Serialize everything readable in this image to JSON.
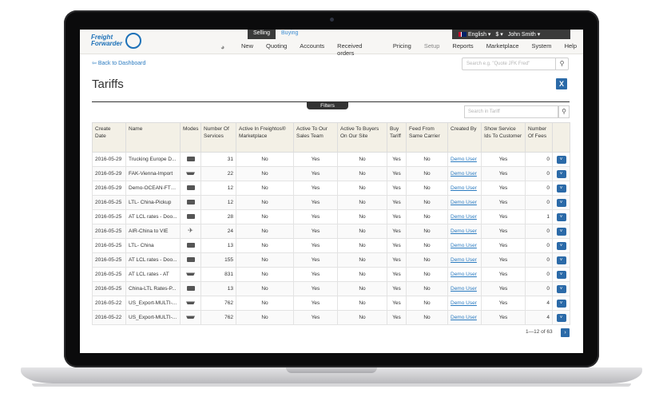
{
  "brand": {
    "logo_line1": "Freight",
    "logo_line2": "Forwarder"
  },
  "mode": {
    "selling": "Selling",
    "buying": "Buying"
  },
  "account": {
    "language": "English",
    "currency": "$",
    "user": "John Smith"
  },
  "nav": [
    "New",
    "Quoting",
    "Accounts",
    "Received orders",
    "Pricing",
    "Setup",
    "Reports",
    "Marketplace",
    "System",
    "Help"
  ],
  "back_link": "Back to Dashboard",
  "search_top_placeholder": "Search e.g. \"Quote JFK Fred\"",
  "page_title": "Tariffs",
  "filters_label": "Filters",
  "search_tariff_placeholder": "Search in Tariff",
  "table": {
    "headers": [
      "Create Date",
      "Name",
      "Modes",
      "Number Of Services",
      "Active In Freightos® Marketplace",
      "Active To Our Sales Team",
      "Active To Buyers On Our Site",
      "Buy Tariff",
      "Feed From Same Carrier",
      "Created By",
      "Show Service Ids To Customer",
      "Number Of Fees",
      ""
    ],
    "rows": [
      {
        "date": "2016-05-29",
        "name": "Trucking Europe D...",
        "mode": "truck",
        "services": "31",
        "marketplace": "No",
        "sales": "Yes",
        "buyers": "No",
        "buy": "Yes",
        "feed": "No",
        "created_by": "Demo User",
        "show_ids": "Yes",
        "fees": "0"
      },
      {
        "date": "2016-05-29",
        "name": "FAK-Vienna-Import",
        "mode": "ship",
        "services": "22",
        "marketplace": "No",
        "sales": "Yes",
        "buyers": "No",
        "buy": "Yes",
        "feed": "No",
        "created_by": "Demo User",
        "show_ids": "Yes",
        "fees": "0"
      },
      {
        "date": "2016-05-29",
        "name": "Demo-OCEAN-FTL...",
        "mode": "truck",
        "services": "12",
        "marketplace": "No",
        "sales": "Yes",
        "buyers": "No",
        "buy": "Yes",
        "feed": "No",
        "created_by": "Demo User",
        "show_ids": "Yes",
        "fees": "0"
      },
      {
        "date": "2016-05-25",
        "name": "LTL- China-Pickup",
        "mode": "truck",
        "services": "12",
        "marketplace": "No",
        "sales": "Yes",
        "buyers": "No",
        "buy": "Yes",
        "feed": "No",
        "created_by": "Demo User",
        "show_ids": "Yes",
        "fees": "0"
      },
      {
        "date": "2016-05-25",
        "name": "AT LCL rates - Doo...",
        "mode": "truck",
        "services": "28",
        "marketplace": "No",
        "sales": "Yes",
        "buyers": "No",
        "buy": "Yes",
        "feed": "No",
        "created_by": "Demo User",
        "show_ids": "Yes",
        "fees": "1"
      },
      {
        "date": "2016-05-25",
        "name": "AIR-China to VIE",
        "mode": "plane",
        "services": "24",
        "marketplace": "No",
        "sales": "Yes",
        "buyers": "No",
        "buy": "Yes",
        "feed": "No",
        "created_by": "Demo User",
        "show_ids": "Yes",
        "fees": "0"
      },
      {
        "date": "2016-05-25",
        "name": "LTL- China",
        "mode": "truck",
        "services": "13",
        "marketplace": "No",
        "sales": "Yes",
        "buyers": "No",
        "buy": "Yes",
        "feed": "No",
        "created_by": "Demo User",
        "show_ids": "Yes",
        "fees": "0"
      },
      {
        "date": "2016-05-25",
        "name": "AT LCL rates - Doo...",
        "mode": "truck",
        "services": "155",
        "marketplace": "No",
        "sales": "Yes",
        "buyers": "No",
        "buy": "Yes",
        "feed": "No",
        "created_by": "Demo User",
        "show_ids": "Yes",
        "fees": "0"
      },
      {
        "date": "2016-05-25",
        "name": "AT LCL rates - AT",
        "mode": "ship",
        "services": "831",
        "marketplace": "No",
        "sales": "Yes",
        "buyers": "No",
        "buy": "Yes",
        "feed": "No",
        "created_by": "Demo User",
        "show_ids": "Yes",
        "fees": "0"
      },
      {
        "date": "2016-05-25",
        "name": "China-LTL Rates-P...",
        "mode": "truck",
        "services": "13",
        "marketplace": "No",
        "sales": "Yes",
        "buyers": "No",
        "buy": "Yes",
        "feed": "No",
        "created_by": "Demo User",
        "show_ids": "Yes",
        "fees": "0"
      },
      {
        "date": "2016-05-22",
        "name": "US_Export-MULTI-...",
        "mode": "ship",
        "services": "762",
        "marketplace": "No",
        "sales": "Yes",
        "buyers": "No",
        "buy": "Yes",
        "feed": "No",
        "created_by": "Demo User",
        "show_ids": "Yes",
        "fees": "4"
      },
      {
        "date": "2016-05-22",
        "name": "US_Export-MULTI-...",
        "mode": "ship",
        "services": "762",
        "marketplace": "No",
        "sales": "Yes",
        "buyers": "No",
        "buy": "Yes",
        "feed": "No",
        "created_by": "Demo User",
        "show_ids": "Yes",
        "fees": "4"
      }
    ]
  },
  "pager": "1—12 of 63",
  "colors": {
    "accent": "#2b6aa8",
    "link": "#2b7bc0",
    "header_bg": "#f3f0e6"
  }
}
